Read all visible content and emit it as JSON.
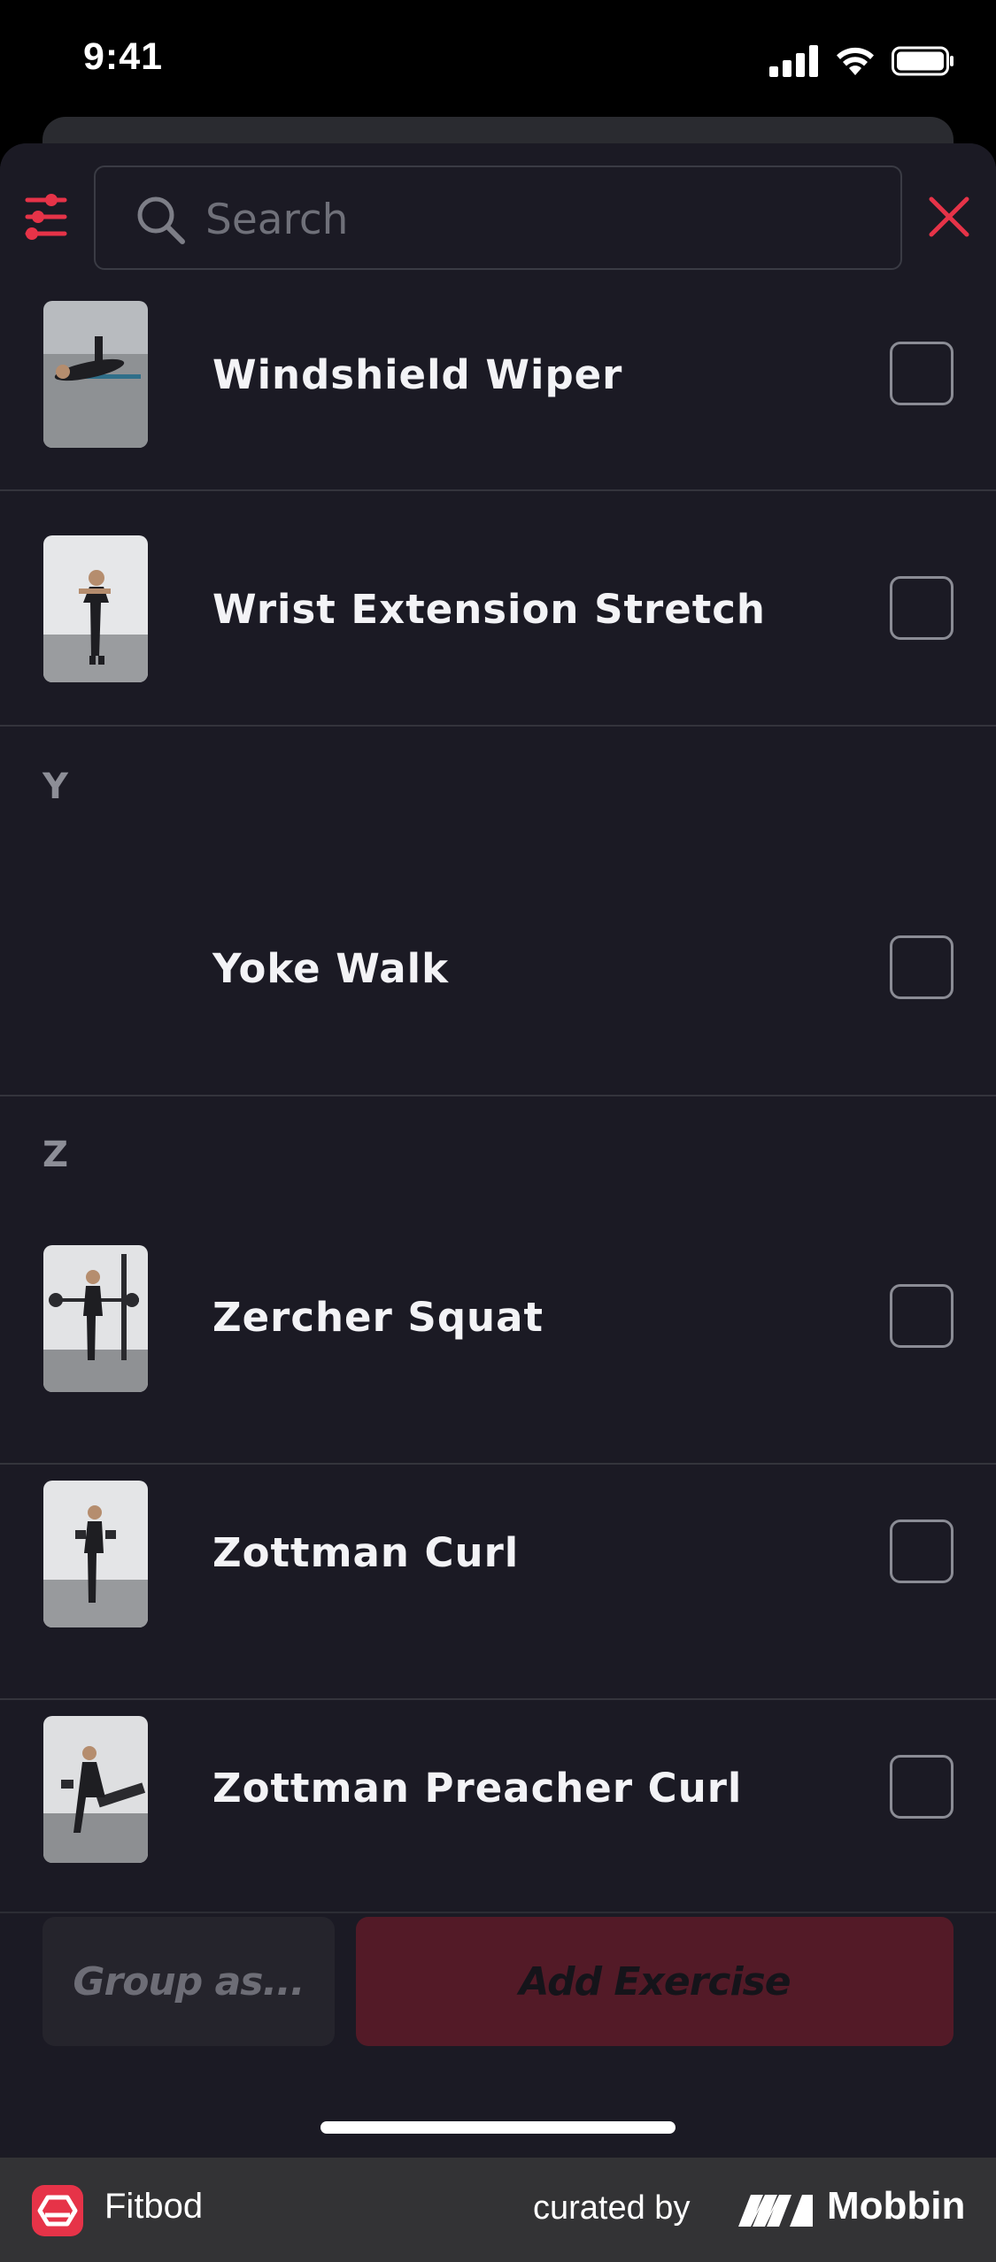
{
  "status_bar": {
    "time": "9:41"
  },
  "search": {
    "placeholder": "Search"
  },
  "list": {
    "items": [
      {
        "label": "Windshield Wiper",
        "has_image": true,
        "checked": false
      },
      {
        "label": "Wrist Extension Stretch",
        "has_image": true,
        "checked": false
      },
      {
        "section": "Y"
      },
      {
        "label": "Yoke Walk",
        "has_image": false,
        "checked": false
      },
      {
        "section": "Z"
      },
      {
        "label": "Zercher Squat",
        "has_image": true,
        "checked": false
      },
      {
        "label": "Zottman Curl",
        "has_image": true,
        "checked": false
      },
      {
        "label": "Zottman Preacher Curl",
        "has_image": true,
        "checked": false
      }
    ]
  },
  "actions": {
    "group_label": "Group as...",
    "add_label": "Add Exercise"
  },
  "branding": {
    "app_name": "Fitbod",
    "curated_by": "curated by",
    "mobbin": "Mobbin"
  },
  "colors": {
    "accent": "#e63348",
    "background": "#1b1a24",
    "add_button": "#531a27"
  }
}
